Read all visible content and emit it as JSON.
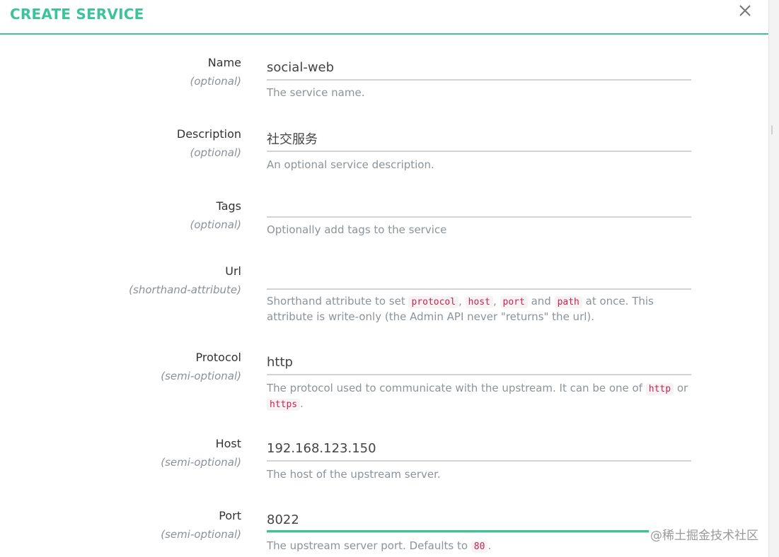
{
  "header": {
    "title": "CREATE SERVICE"
  },
  "fields": {
    "name": {
      "label": "Name",
      "sub": "(optional)",
      "value": "social-web",
      "help": "The service name."
    },
    "description": {
      "label": "Description",
      "sub": "(optional)",
      "value": "社交服务",
      "help": "An optional service description."
    },
    "tags": {
      "label": "Tags",
      "sub": "(optional)",
      "value": "",
      "help": "Optionally add tags to the service"
    },
    "url": {
      "label": "Url",
      "sub": "(shorthand-attribute)",
      "value": "",
      "help": {
        "t1": "Shorthand attribute to set ",
        "c1": "protocol",
        "t2": ", ",
        "c2": "host",
        "t3": ", ",
        "c3": "port",
        "t4": " and ",
        "c4": "path",
        "t5": " at once. This attribute is write-only (the Admin API never \"returns\" the url)."
      }
    },
    "protocol": {
      "label": "Protocol",
      "sub": "(semi-optional)",
      "value": "http",
      "help": {
        "t1": "The protocol used to communicate with the upstream. It can be one of ",
        "c1": "http",
        "t2": " or ",
        "c2": "https",
        "t3": "."
      }
    },
    "host": {
      "label": "Host",
      "sub": "(semi-optional)",
      "value": "192.168.123.150",
      "help": "The host of the upstream server."
    },
    "port": {
      "label": "Port",
      "sub": "(semi-optional)",
      "value": "8022",
      "help": {
        "t1": "The upstream server port. Defaults to ",
        "c1": "80",
        "t2": "."
      }
    }
  },
  "watermark": "@稀土掘金技术社区",
  "colors": {
    "accent": "#3cc39b",
    "code": "#c7254e"
  }
}
